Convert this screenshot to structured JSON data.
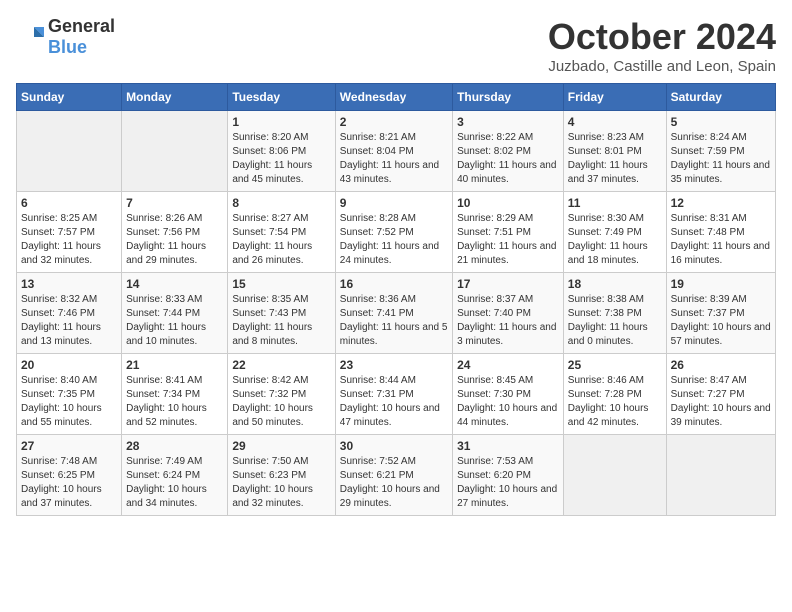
{
  "header": {
    "logo_general": "General",
    "logo_blue": "Blue",
    "title": "October 2024",
    "subtitle": "Juzbado, Castille and Leon, Spain"
  },
  "days_of_week": [
    "Sunday",
    "Monday",
    "Tuesday",
    "Wednesday",
    "Thursday",
    "Friday",
    "Saturday"
  ],
  "weeks": [
    [
      {
        "day": "",
        "info": ""
      },
      {
        "day": "",
        "info": ""
      },
      {
        "day": "1",
        "info": "Sunrise: 8:20 AM\nSunset: 8:06 PM\nDaylight: 11 hours and 45 minutes."
      },
      {
        "day": "2",
        "info": "Sunrise: 8:21 AM\nSunset: 8:04 PM\nDaylight: 11 hours and 43 minutes."
      },
      {
        "day": "3",
        "info": "Sunrise: 8:22 AM\nSunset: 8:02 PM\nDaylight: 11 hours and 40 minutes."
      },
      {
        "day": "4",
        "info": "Sunrise: 8:23 AM\nSunset: 8:01 PM\nDaylight: 11 hours and 37 minutes."
      },
      {
        "day": "5",
        "info": "Sunrise: 8:24 AM\nSunset: 7:59 PM\nDaylight: 11 hours and 35 minutes."
      }
    ],
    [
      {
        "day": "6",
        "info": "Sunrise: 8:25 AM\nSunset: 7:57 PM\nDaylight: 11 hours and 32 minutes."
      },
      {
        "day": "7",
        "info": "Sunrise: 8:26 AM\nSunset: 7:56 PM\nDaylight: 11 hours and 29 minutes."
      },
      {
        "day": "8",
        "info": "Sunrise: 8:27 AM\nSunset: 7:54 PM\nDaylight: 11 hours and 26 minutes."
      },
      {
        "day": "9",
        "info": "Sunrise: 8:28 AM\nSunset: 7:52 PM\nDaylight: 11 hours and 24 minutes."
      },
      {
        "day": "10",
        "info": "Sunrise: 8:29 AM\nSunset: 7:51 PM\nDaylight: 11 hours and 21 minutes."
      },
      {
        "day": "11",
        "info": "Sunrise: 8:30 AM\nSunset: 7:49 PM\nDaylight: 11 hours and 18 minutes."
      },
      {
        "day": "12",
        "info": "Sunrise: 8:31 AM\nSunset: 7:48 PM\nDaylight: 11 hours and 16 minutes."
      }
    ],
    [
      {
        "day": "13",
        "info": "Sunrise: 8:32 AM\nSunset: 7:46 PM\nDaylight: 11 hours and 13 minutes."
      },
      {
        "day": "14",
        "info": "Sunrise: 8:33 AM\nSunset: 7:44 PM\nDaylight: 11 hours and 10 minutes."
      },
      {
        "day": "15",
        "info": "Sunrise: 8:35 AM\nSunset: 7:43 PM\nDaylight: 11 hours and 8 minutes."
      },
      {
        "day": "16",
        "info": "Sunrise: 8:36 AM\nSunset: 7:41 PM\nDaylight: 11 hours and 5 minutes."
      },
      {
        "day": "17",
        "info": "Sunrise: 8:37 AM\nSunset: 7:40 PM\nDaylight: 11 hours and 3 minutes."
      },
      {
        "day": "18",
        "info": "Sunrise: 8:38 AM\nSunset: 7:38 PM\nDaylight: 11 hours and 0 minutes."
      },
      {
        "day": "19",
        "info": "Sunrise: 8:39 AM\nSunset: 7:37 PM\nDaylight: 10 hours and 57 minutes."
      }
    ],
    [
      {
        "day": "20",
        "info": "Sunrise: 8:40 AM\nSunset: 7:35 PM\nDaylight: 10 hours and 55 minutes."
      },
      {
        "day": "21",
        "info": "Sunrise: 8:41 AM\nSunset: 7:34 PM\nDaylight: 10 hours and 52 minutes."
      },
      {
        "day": "22",
        "info": "Sunrise: 8:42 AM\nSunset: 7:32 PM\nDaylight: 10 hours and 50 minutes."
      },
      {
        "day": "23",
        "info": "Sunrise: 8:44 AM\nSunset: 7:31 PM\nDaylight: 10 hours and 47 minutes."
      },
      {
        "day": "24",
        "info": "Sunrise: 8:45 AM\nSunset: 7:30 PM\nDaylight: 10 hours and 44 minutes."
      },
      {
        "day": "25",
        "info": "Sunrise: 8:46 AM\nSunset: 7:28 PM\nDaylight: 10 hours and 42 minutes."
      },
      {
        "day": "26",
        "info": "Sunrise: 8:47 AM\nSunset: 7:27 PM\nDaylight: 10 hours and 39 minutes."
      }
    ],
    [
      {
        "day": "27",
        "info": "Sunrise: 7:48 AM\nSunset: 6:25 PM\nDaylight: 10 hours and 37 minutes."
      },
      {
        "day": "28",
        "info": "Sunrise: 7:49 AM\nSunset: 6:24 PM\nDaylight: 10 hours and 34 minutes."
      },
      {
        "day": "29",
        "info": "Sunrise: 7:50 AM\nSunset: 6:23 PM\nDaylight: 10 hours and 32 minutes."
      },
      {
        "day": "30",
        "info": "Sunrise: 7:52 AM\nSunset: 6:21 PM\nDaylight: 10 hours and 29 minutes."
      },
      {
        "day": "31",
        "info": "Sunrise: 7:53 AM\nSunset: 6:20 PM\nDaylight: 10 hours and 27 minutes."
      },
      {
        "day": "",
        "info": ""
      },
      {
        "day": "",
        "info": ""
      }
    ]
  ]
}
